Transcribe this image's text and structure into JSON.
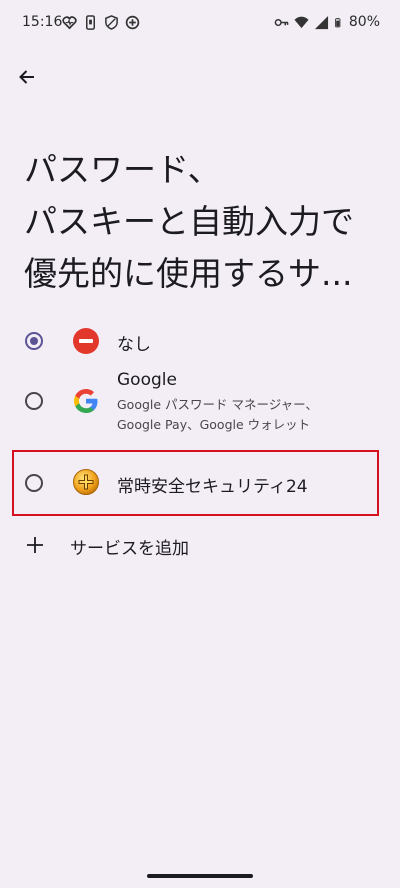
{
  "status_bar": {
    "time": "15:16",
    "battery": "80%",
    "icons": [
      "heart-health-icon",
      "phone-icon",
      "shield-icon",
      "data-saver-icon",
      "vpn-key-icon",
      "wifi-icon",
      "signal-icon",
      "battery-icon"
    ]
  },
  "header": {
    "back_icon": "arrow-back-icon"
  },
  "title": "パスワード、\nパスキーと自動入力で\n優先的に使用するサ...",
  "options": [
    {
      "label": "なし",
      "selected": true,
      "icon": "none-red-icon"
    },
    {
      "label": "Google",
      "subtitle": "Google パスワード マネージャー、\nGoogle Pay、Google ウォレット",
      "selected": false,
      "icon": "google-g-icon"
    },
    {
      "label": "常時安全セキュリティ24",
      "selected": false,
      "icon": "security24-icon"
    }
  ],
  "add_service": {
    "label": "サービスを追加",
    "icon": "plus-icon"
  },
  "colors": {
    "background": "#f3eef6",
    "radio_accent": "#5b5495",
    "highlight": "#d6111f"
  }
}
